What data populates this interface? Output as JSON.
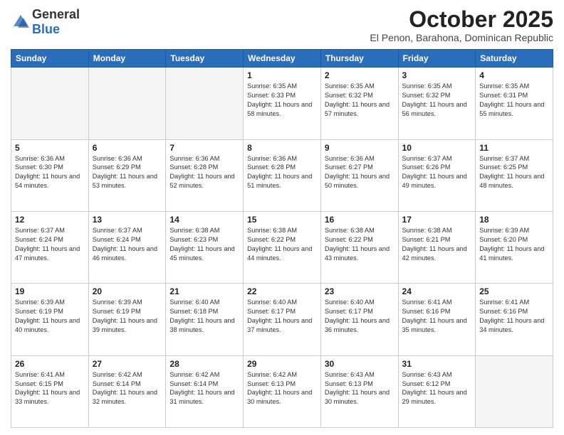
{
  "logo": {
    "general": "General",
    "blue": "Blue"
  },
  "title": "October 2025",
  "subtitle": "El Penon, Barahona, Dominican Republic",
  "days_of_week": [
    "Sunday",
    "Monday",
    "Tuesday",
    "Wednesday",
    "Thursday",
    "Friday",
    "Saturday"
  ],
  "weeks": [
    [
      {
        "day": null,
        "sunrise": null,
        "sunset": null,
        "daylight": null
      },
      {
        "day": null,
        "sunrise": null,
        "sunset": null,
        "daylight": null
      },
      {
        "day": null,
        "sunrise": null,
        "sunset": null,
        "daylight": null
      },
      {
        "day": "1",
        "sunrise": "6:35 AM",
        "sunset": "6:33 PM",
        "daylight": "11 hours and 58 minutes."
      },
      {
        "day": "2",
        "sunrise": "6:35 AM",
        "sunset": "6:32 PM",
        "daylight": "11 hours and 57 minutes."
      },
      {
        "day": "3",
        "sunrise": "6:35 AM",
        "sunset": "6:32 PM",
        "daylight": "11 hours and 56 minutes."
      },
      {
        "day": "4",
        "sunrise": "6:35 AM",
        "sunset": "6:31 PM",
        "daylight": "11 hours and 55 minutes."
      }
    ],
    [
      {
        "day": "5",
        "sunrise": "6:36 AM",
        "sunset": "6:30 PM",
        "daylight": "11 hours and 54 minutes."
      },
      {
        "day": "6",
        "sunrise": "6:36 AM",
        "sunset": "6:29 PM",
        "daylight": "11 hours and 53 minutes."
      },
      {
        "day": "7",
        "sunrise": "6:36 AM",
        "sunset": "6:28 PM",
        "daylight": "11 hours and 52 minutes."
      },
      {
        "day": "8",
        "sunrise": "6:36 AM",
        "sunset": "6:28 PM",
        "daylight": "11 hours and 51 minutes."
      },
      {
        "day": "9",
        "sunrise": "6:36 AM",
        "sunset": "6:27 PM",
        "daylight": "11 hours and 50 minutes."
      },
      {
        "day": "10",
        "sunrise": "6:37 AM",
        "sunset": "6:26 PM",
        "daylight": "11 hours and 49 minutes."
      },
      {
        "day": "11",
        "sunrise": "6:37 AM",
        "sunset": "6:25 PM",
        "daylight": "11 hours and 48 minutes."
      }
    ],
    [
      {
        "day": "12",
        "sunrise": "6:37 AM",
        "sunset": "6:24 PM",
        "daylight": "11 hours and 47 minutes."
      },
      {
        "day": "13",
        "sunrise": "6:37 AM",
        "sunset": "6:24 PM",
        "daylight": "11 hours and 46 minutes."
      },
      {
        "day": "14",
        "sunrise": "6:38 AM",
        "sunset": "6:23 PM",
        "daylight": "11 hours and 45 minutes."
      },
      {
        "day": "15",
        "sunrise": "6:38 AM",
        "sunset": "6:22 PM",
        "daylight": "11 hours and 44 minutes."
      },
      {
        "day": "16",
        "sunrise": "6:38 AM",
        "sunset": "6:22 PM",
        "daylight": "11 hours and 43 minutes."
      },
      {
        "day": "17",
        "sunrise": "6:38 AM",
        "sunset": "6:21 PM",
        "daylight": "11 hours and 42 minutes."
      },
      {
        "day": "18",
        "sunrise": "6:39 AM",
        "sunset": "6:20 PM",
        "daylight": "11 hours and 41 minutes."
      }
    ],
    [
      {
        "day": "19",
        "sunrise": "6:39 AM",
        "sunset": "6:19 PM",
        "daylight": "11 hours and 40 minutes."
      },
      {
        "day": "20",
        "sunrise": "6:39 AM",
        "sunset": "6:19 PM",
        "daylight": "11 hours and 39 minutes."
      },
      {
        "day": "21",
        "sunrise": "6:40 AM",
        "sunset": "6:18 PM",
        "daylight": "11 hours and 38 minutes."
      },
      {
        "day": "22",
        "sunrise": "6:40 AM",
        "sunset": "6:17 PM",
        "daylight": "11 hours and 37 minutes."
      },
      {
        "day": "23",
        "sunrise": "6:40 AM",
        "sunset": "6:17 PM",
        "daylight": "11 hours and 36 minutes."
      },
      {
        "day": "24",
        "sunrise": "6:41 AM",
        "sunset": "6:16 PM",
        "daylight": "11 hours and 35 minutes."
      },
      {
        "day": "25",
        "sunrise": "6:41 AM",
        "sunset": "6:16 PM",
        "daylight": "11 hours and 34 minutes."
      }
    ],
    [
      {
        "day": "26",
        "sunrise": "6:41 AM",
        "sunset": "6:15 PM",
        "daylight": "11 hours and 33 minutes."
      },
      {
        "day": "27",
        "sunrise": "6:42 AM",
        "sunset": "6:14 PM",
        "daylight": "11 hours and 32 minutes."
      },
      {
        "day": "28",
        "sunrise": "6:42 AM",
        "sunset": "6:14 PM",
        "daylight": "11 hours and 31 minutes."
      },
      {
        "day": "29",
        "sunrise": "6:42 AM",
        "sunset": "6:13 PM",
        "daylight": "11 hours and 30 minutes."
      },
      {
        "day": "30",
        "sunrise": "6:43 AM",
        "sunset": "6:13 PM",
        "daylight": "11 hours and 30 minutes."
      },
      {
        "day": "31",
        "sunrise": "6:43 AM",
        "sunset": "6:12 PM",
        "daylight": "11 hours and 29 minutes."
      },
      {
        "day": null,
        "sunrise": null,
        "sunset": null,
        "daylight": null
      }
    ]
  ]
}
